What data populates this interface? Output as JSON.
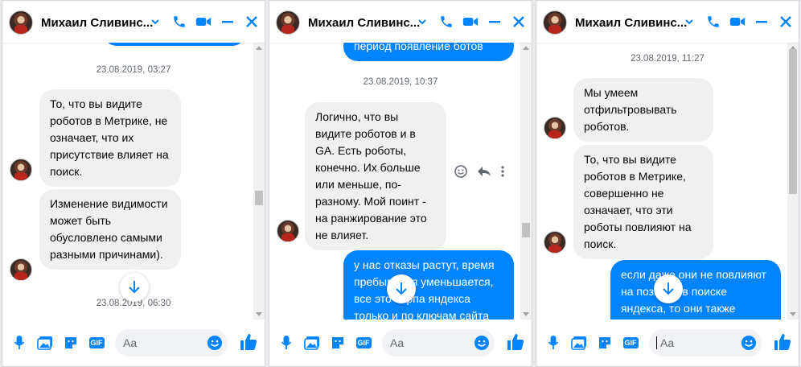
{
  "contact_name": "Михаил Сливинс...",
  "input_placeholder": "Aa",
  "colors": {
    "accent": "#0084ff",
    "incoming_bubble": "#f0f0f0",
    "outgoing_bubble": "#0084ff"
  },
  "icons": {
    "header": [
      "chevron-down-icon",
      "phone-icon",
      "video-icon",
      "minimize-icon",
      "close-icon"
    ],
    "footer": [
      "microphone-icon",
      "image-icon",
      "sticker-icon",
      "gif-icon",
      "emoji-icon",
      "thumbs-up-icon"
    ]
  },
  "gif_label": "GIF",
  "panels": [
    {
      "dates": [
        "23.08.2019, 03:27",
        "23.08.2019, 06:30"
      ],
      "messages": [
        {
          "direction": "in",
          "text": "То, что вы видите роботов в Метрике, не означает, что их присутствие влияет на поиск."
        },
        {
          "direction": "in",
          "text": "Изменение видимости может быть обусловлено самыми разными причинами)."
        }
      ]
    },
    {
      "dates": [
        "23.08.2019, 10:37"
      ],
      "messages": [
        {
          "direction": "out",
          "text": "период появление ботов"
        },
        {
          "direction": "in",
          "text": "Логично, что вы видите роботов и в GA. Есть роботы, конечно. Их больше или меньше, по-разному. Мой поинт - на ранжирование это не влияет."
        },
        {
          "direction": "out",
          "text": "у нас отказы растут, время пребывания уменьшается, все это серпа яндекса только и по ключам сайта"
        }
      ]
    },
    {
      "dates": [
        "23.08.2019, 11:27"
      ],
      "messages": [
        {
          "direction": "in",
          "text": "Мы умеем отфильтровывать роботов."
        },
        {
          "direction": "in",
          "text": "То, что вы видите роботов в Метрике, совершенно не означает, что эти роботы повлияют на поиск."
        },
        {
          "direction": "out",
          "text": "если даже они не повлияют на позиции в поиске яндекса, то они также влияют на поведенч"
        }
      ]
    }
  ]
}
